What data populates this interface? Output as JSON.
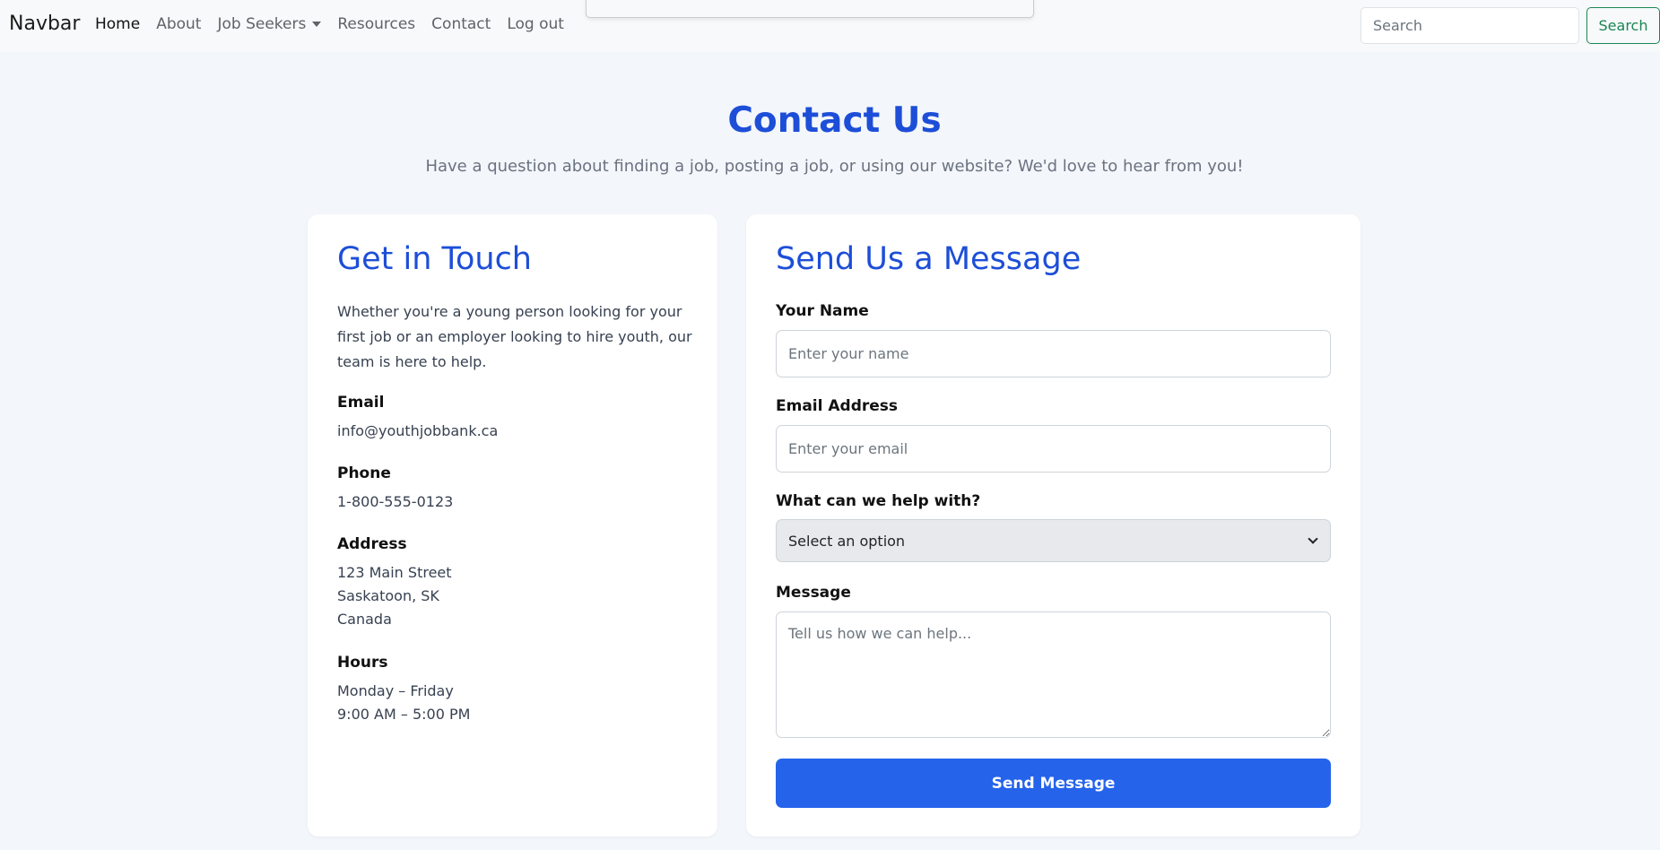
{
  "navbar": {
    "brand": "Navbar",
    "links": [
      "Home",
      "About",
      "Job Seekers",
      "Resources",
      "Contact",
      "Log out"
    ],
    "search_placeholder": "Search",
    "search_button": "Search"
  },
  "header": {
    "title": "Contact Us",
    "subtitle": "Have a question about finding a job, posting a job, or using our website? We'd love to hear from you!"
  },
  "contact_info": {
    "heading": "Get in Touch",
    "intro": "Whether you're a young person looking for your first job or an employer looking to hire youth, our team is here to help.",
    "email_label": "Email",
    "email": "info@youthjobbank.ca",
    "phone_label": "Phone",
    "phone": "1-800-555-0123",
    "address_label": "Address",
    "address_line1": "123 Main Street",
    "address_line2": "Saskatoon, SK",
    "address_line3": "Canada",
    "hours_label": "Hours",
    "hours_line1": "Monday – Friday",
    "hours_line2": "9:00 AM – 5:00 PM"
  },
  "form": {
    "heading": "Send Us a Message",
    "name_label": "Your Name",
    "name_placeholder": "Enter your name",
    "email_label": "Email Address",
    "email_placeholder": "Enter your email",
    "topic_label": "What can we help with?",
    "topic_selected": "Select an option",
    "message_label": "Message",
    "message_placeholder": "Tell us how we can help...",
    "submit": "Send Message"
  },
  "colors": {
    "accent": "#1d4ed8",
    "button": "#2563eb",
    "search_outline": "#198754"
  }
}
